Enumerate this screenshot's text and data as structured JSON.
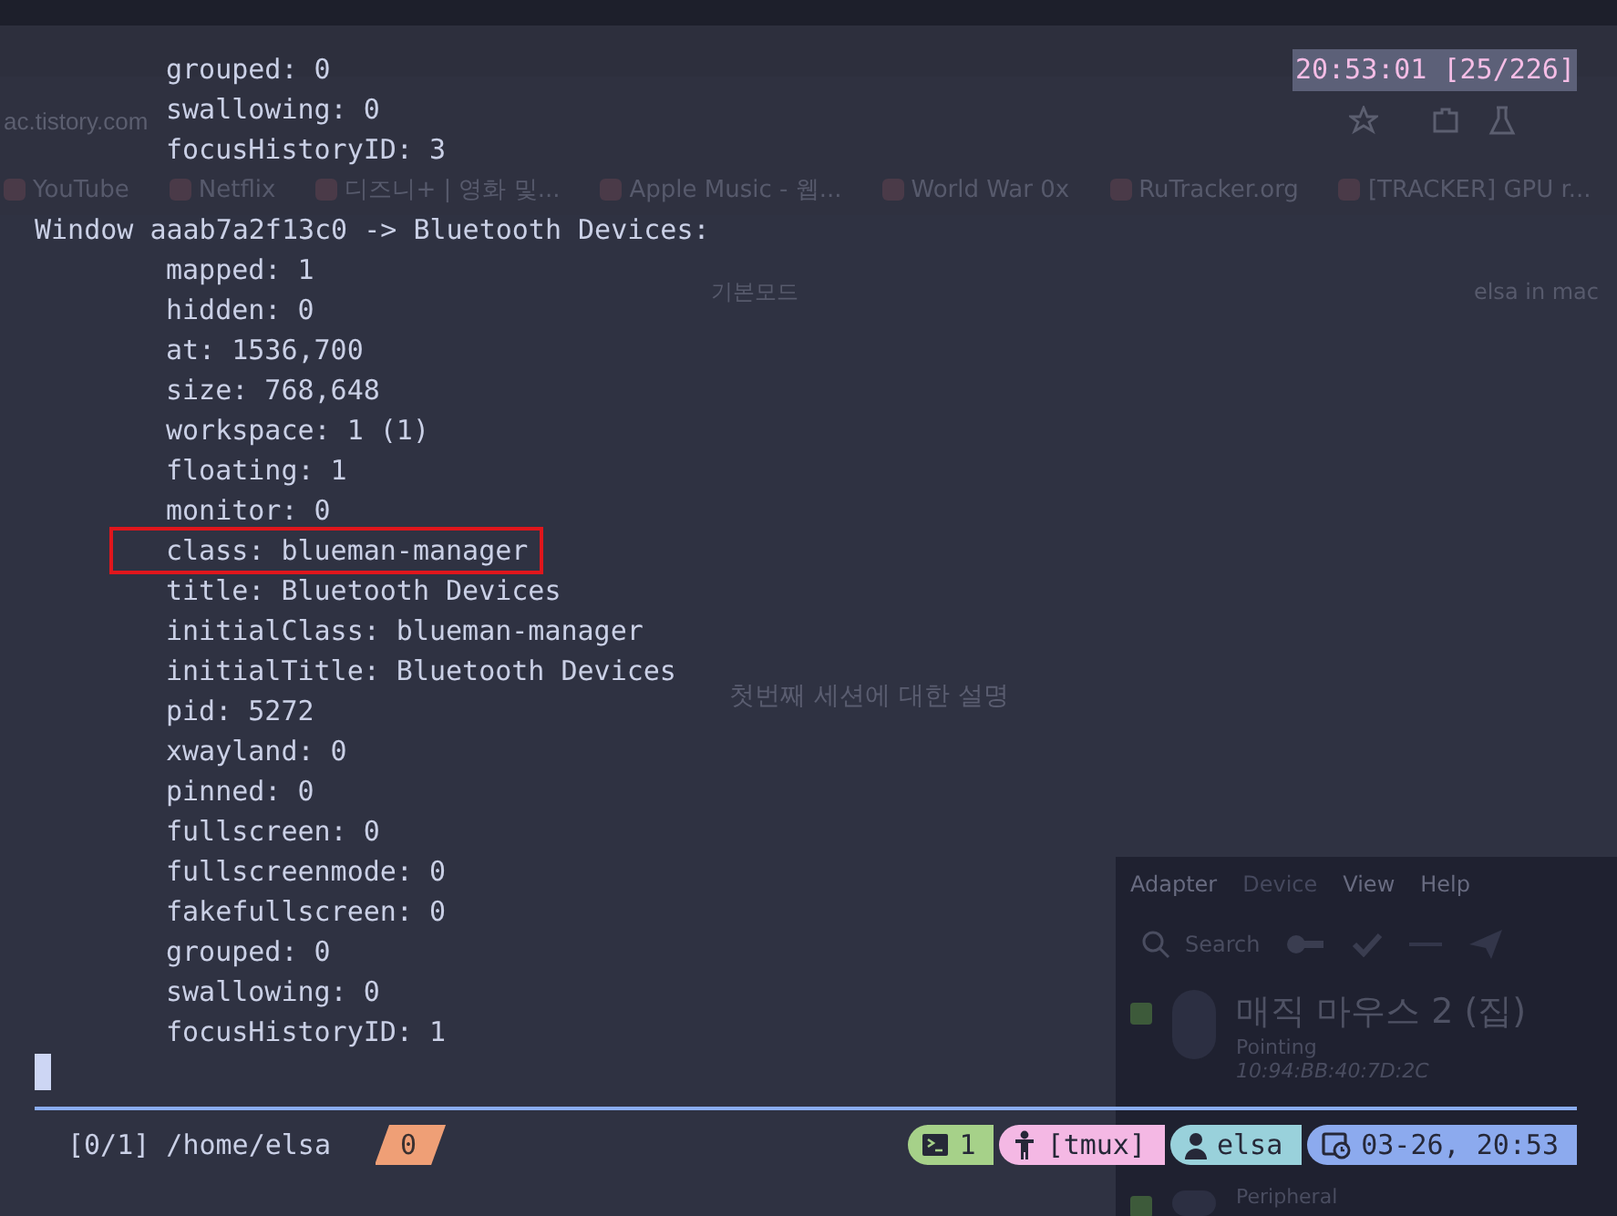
{
  "browser": {
    "url": "ac.tistory.com",
    "bookmarks": [
      "YouTube",
      "Netflix",
      "디즈니+ | 영화 및...",
      "Apple Music - 웹...",
      "World War 0x",
      "RuTracker.org",
      "[TRACKER] GPU r..."
    ],
    "editor_mode": "기본모드",
    "editor_user": "elsa in mac",
    "article_text": "첫번째 세션에 대한 설명"
  },
  "bluetooth_window": {
    "menu": [
      {
        "label": "Adapter",
        "disabled": false
      },
      {
        "label": "Device",
        "disabled": true
      },
      {
        "label": "View",
        "disabled": false
      },
      {
        "label": "Help",
        "disabled": false
      }
    ],
    "search": "Search",
    "devices": [
      {
        "name": "매직 마우스 2 (집)",
        "type": "Pointing",
        "address": "10:94:BB:40:7D:2C",
        "checked": true
      },
      {
        "type": "Peripheral",
        "checked": true
      }
    ]
  },
  "terminal": {
    "clock": "20:53:01 [25/226]",
    "lines": [
      {
        "kind": "property",
        "text": "grouped: 0"
      },
      {
        "kind": "property",
        "text": "swallowing: 0"
      },
      {
        "kind": "property",
        "text": "focusHistoryID: 3"
      },
      {
        "kind": "blank"
      },
      {
        "kind": "header",
        "text": "Window aaab7a2f13c0 -> Bluetooth Devices:"
      },
      {
        "kind": "property",
        "text": "mapped: 1"
      },
      {
        "kind": "property",
        "text": "hidden: 0"
      },
      {
        "kind": "property",
        "text": "at: 1536,700"
      },
      {
        "kind": "property",
        "text": "size: 768,648"
      },
      {
        "kind": "property",
        "text": "workspace: 1 (1)"
      },
      {
        "kind": "property",
        "text": "floating: 1"
      },
      {
        "kind": "property",
        "text": "monitor: 0"
      },
      {
        "kind": "property",
        "text": "class: blueman-manager",
        "highlighted": true
      },
      {
        "kind": "property",
        "text": "title: Bluetooth Devices"
      },
      {
        "kind": "property",
        "text": "initialClass: blueman-manager"
      },
      {
        "kind": "property",
        "text": "initialTitle: Bluetooth Devices"
      },
      {
        "kind": "property",
        "text": "pid: 5272"
      },
      {
        "kind": "property",
        "text": "xwayland: 0"
      },
      {
        "kind": "property",
        "text": "pinned: 0"
      },
      {
        "kind": "property",
        "text": "fullscreen: 0"
      },
      {
        "kind": "property",
        "text": "fullscreenmode: 0"
      },
      {
        "kind": "property",
        "text": "fakefullscreen: 0"
      },
      {
        "kind": "property",
        "text": "grouped: 0"
      },
      {
        "kind": "property",
        "text": "swallowing: 0"
      },
      {
        "kind": "property",
        "text": "focusHistoryID: 1"
      }
    ]
  },
  "status_bar": {
    "session": "[0/1] /home/elsa",
    "window": "0",
    "segments": [
      {
        "kind": "windows",
        "text": "1",
        "color": "#a6d189"
      },
      {
        "kind": "session",
        "text": "[tmux]",
        "color": "#f4b8e4"
      },
      {
        "kind": "user",
        "text": "elsa",
        "color": "#99d1db"
      },
      {
        "kind": "datetime",
        "text": "03-26, 20:53",
        "color": "#8caaee"
      }
    ]
  }
}
